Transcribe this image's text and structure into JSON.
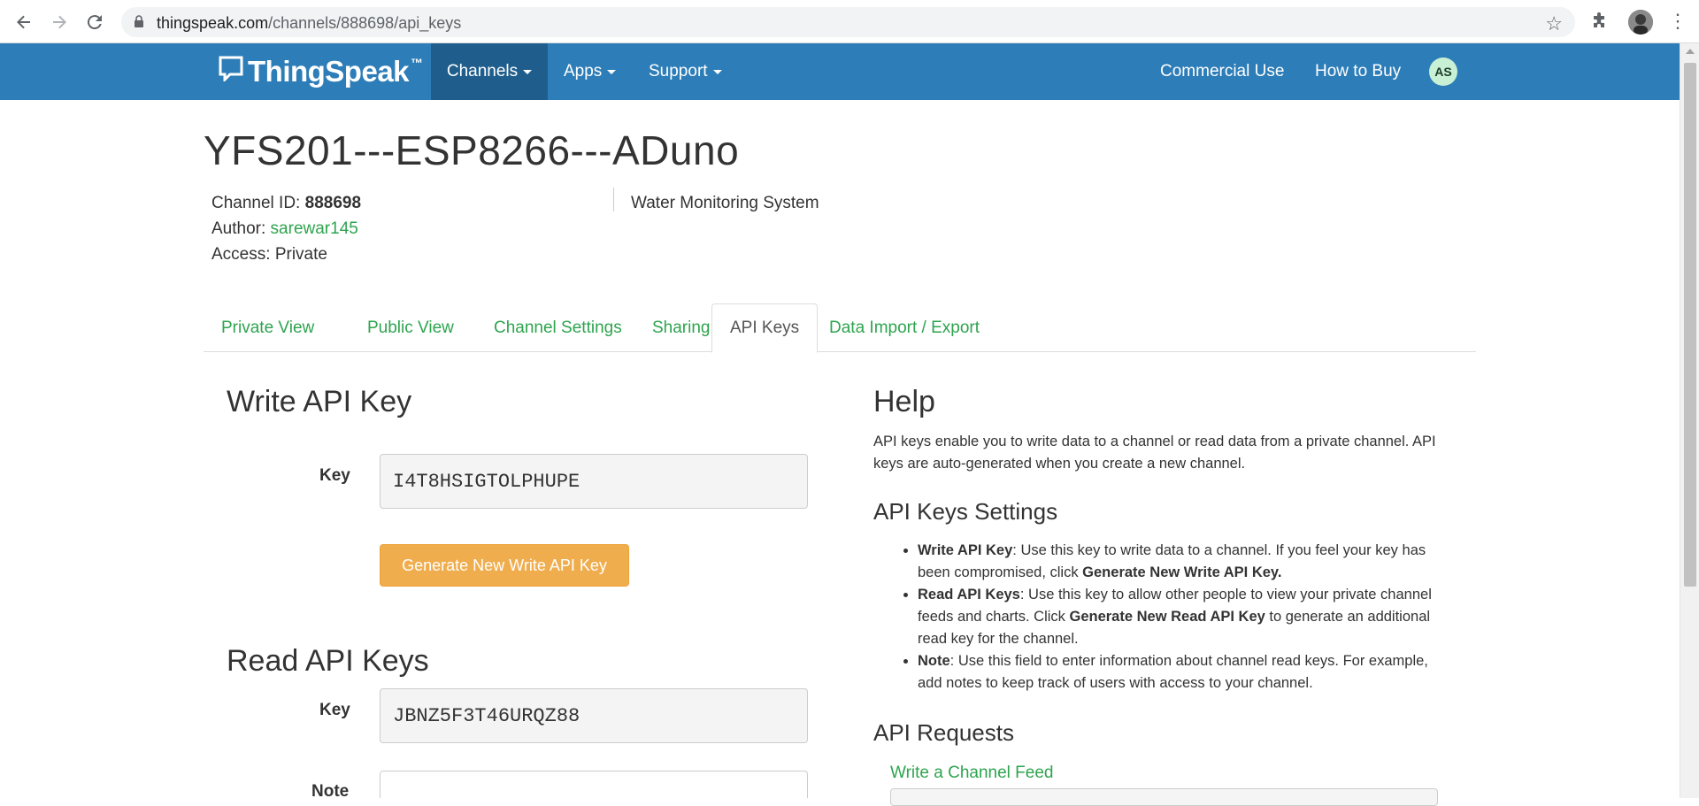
{
  "browser": {
    "url_host": "thingspeak.com",
    "url_path": "/channels/888698/api_keys"
  },
  "navbar": {
    "brand": "ThingSpeak",
    "brand_tm": "™",
    "menu": [
      {
        "label": "Channels"
      },
      {
        "label": "Apps"
      },
      {
        "label": "Support"
      }
    ],
    "right": [
      {
        "label": "Commercial Use"
      },
      {
        "label": "How to Buy"
      }
    ],
    "avatar_initials": "AS"
  },
  "channel": {
    "title": "YFS201---ESP8266---ADuno",
    "id_label": "Channel ID: ",
    "id_value": "888698",
    "author_label": "Author: ",
    "author_value": "sarewar145",
    "access_label": "Access: ",
    "access_value": "Private",
    "description": "Water Monitoring System"
  },
  "tabs": [
    {
      "label": "Private View"
    },
    {
      "label": "Public View"
    },
    {
      "label": "Channel Settings"
    },
    {
      "label": "Sharing"
    },
    {
      "label": "API Keys"
    },
    {
      "label": "Data Import / Export"
    }
  ],
  "write_key": {
    "heading": "Write API Key",
    "label": "Key",
    "value": "I4T8HSIGTOLPHUPE",
    "button": "Generate New Write API Key"
  },
  "read_keys": {
    "heading": "Read API Keys",
    "key_label": "Key",
    "key_value": "JBNZ5F3T46URQZ88",
    "note_label": "Note",
    "note_value": ""
  },
  "help": {
    "heading": "Help",
    "intro": "API keys enable you to write data to a channel or read data from a private channel. API keys are auto-generated when you create a new channel.",
    "settings_heading": "API Keys Settings",
    "items": [
      {
        "title": "Write API Key",
        "text_a": ": Use this key to write data to a channel. If you feel your key has been compromised, click ",
        "strong": "Generate New Write API Key.",
        "text_b": ""
      },
      {
        "title": "Read API Keys",
        "text_a": ": Use this key to allow other people to view your private channel feeds and charts. Click ",
        "strong": "Generate New Read API Key",
        "text_b": " to generate an additional read key for the channel."
      },
      {
        "title": "Note",
        "text_a": ": Use this field to enter information about channel read keys. For example, add notes to keep track of users with access to your channel.",
        "strong": "",
        "text_b": ""
      }
    ],
    "requests_heading": "API Requests",
    "requests_link": "Write a Channel Feed"
  },
  "colors": {
    "navbar": "#2d7db8",
    "navbar_active": "#1f5e8c",
    "link_green": "#2ea44f",
    "button_orange": "#f0ad4e"
  }
}
